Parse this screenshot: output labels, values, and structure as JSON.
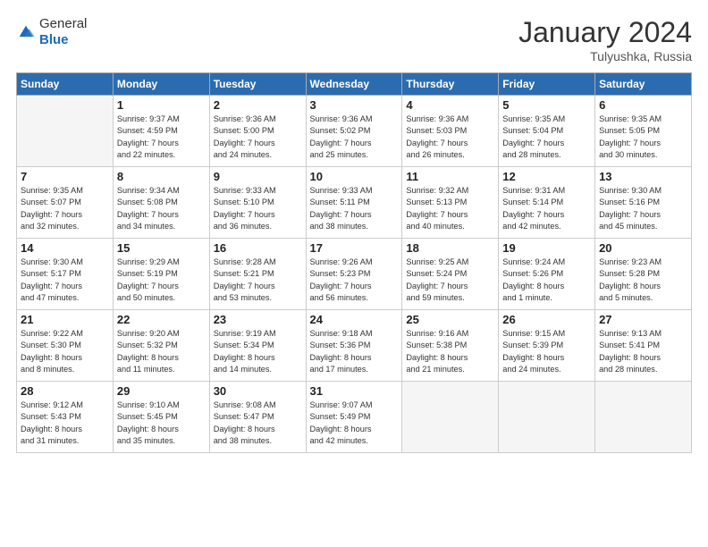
{
  "header": {
    "logo": {
      "general": "General",
      "blue": "Blue"
    },
    "title": "January 2024",
    "location": "Tulyushka, Russia"
  },
  "calendar": {
    "weekdays": [
      "Sunday",
      "Monday",
      "Tuesday",
      "Wednesday",
      "Thursday",
      "Friday",
      "Saturday"
    ],
    "weeks": [
      [
        {
          "day": "",
          "info": ""
        },
        {
          "day": "1",
          "info": "Sunrise: 9:37 AM\nSunset: 4:59 PM\nDaylight: 7 hours\nand 22 minutes."
        },
        {
          "day": "2",
          "info": "Sunrise: 9:36 AM\nSunset: 5:00 PM\nDaylight: 7 hours\nand 24 minutes."
        },
        {
          "day": "3",
          "info": "Sunrise: 9:36 AM\nSunset: 5:02 PM\nDaylight: 7 hours\nand 25 minutes."
        },
        {
          "day": "4",
          "info": "Sunrise: 9:36 AM\nSunset: 5:03 PM\nDaylight: 7 hours\nand 26 minutes."
        },
        {
          "day": "5",
          "info": "Sunrise: 9:35 AM\nSunset: 5:04 PM\nDaylight: 7 hours\nand 28 minutes."
        },
        {
          "day": "6",
          "info": "Sunrise: 9:35 AM\nSunset: 5:05 PM\nDaylight: 7 hours\nand 30 minutes."
        }
      ],
      [
        {
          "day": "7",
          "info": "Sunrise: 9:35 AM\nSunset: 5:07 PM\nDaylight: 7 hours\nand 32 minutes."
        },
        {
          "day": "8",
          "info": "Sunrise: 9:34 AM\nSunset: 5:08 PM\nDaylight: 7 hours\nand 34 minutes."
        },
        {
          "day": "9",
          "info": "Sunrise: 9:33 AM\nSunset: 5:10 PM\nDaylight: 7 hours\nand 36 minutes."
        },
        {
          "day": "10",
          "info": "Sunrise: 9:33 AM\nSunset: 5:11 PM\nDaylight: 7 hours\nand 38 minutes."
        },
        {
          "day": "11",
          "info": "Sunrise: 9:32 AM\nSunset: 5:13 PM\nDaylight: 7 hours\nand 40 minutes."
        },
        {
          "day": "12",
          "info": "Sunrise: 9:31 AM\nSunset: 5:14 PM\nDaylight: 7 hours\nand 42 minutes."
        },
        {
          "day": "13",
          "info": "Sunrise: 9:30 AM\nSunset: 5:16 PM\nDaylight: 7 hours\nand 45 minutes."
        }
      ],
      [
        {
          "day": "14",
          "info": "Sunrise: 9:30 AM\nSunset: 5:17 PM\nDaylight: 7 hours\nand 47 minutes."
        },
        {
          "day": "15",
          "info": "Sunrise: 9:29 AM\nSunset: 5:19 PM\nDaylight: 7 hours\nand 50 minutes."
        },
        {
          "day": "16",
          "info": "Sunrise: 9:28 AM\nSunset: 5:21 PM\nDaylight: 7 hours\nand 53 minutes."
        },
        {
          "day": "17",
          "info": "Sunrise: 9:26 AM\nSunset: 5:23 PM\nDaylight: 7 hours\nand 56 minutes."
        },
        {
          "day": "18",
          "info": "Sunrise: 9:25 AM\nSunset: 5:24 PM\nDaylight: 7 hours\nand 59 minutes."
        },
        {
          "day": "19",
          "info": "Sunrise: 9:24 AM\nSunset: 5:26 PM\nDaylight: 8 hours\nand 1 minute."
        },
        {
          "day": "20",
          "info": "Sunrise: 9:23 AM\nSunset: 5:28 PM\nDaylight: 8 hours\nand 5 minutes."
        }
      ],
      [
        {
          "day": "21",
          "info": "Sunrise: 9:22 AM\nSunset: 5:30 PM\nDaylight: 8 hours\nand 8 minutes."
        },
        {
          "day": "22",
          "info": "Sunrise: 9:20 AM\nSunset: 5:32 PM\nDaylight: 8 hours\nand 11 minutes."
        },
        {
          "day": "23",
          "info": "Sunrise: 9:19 AM\nSunset: 5:34 PM\nDaylight: 8 hours\nand 14 minutes."
        },
        {
          "day": "24",
          "info": "Sunrise: 9:18 AM\nSunset: 5:36 PM\nDaylight: 8 hours\nand 17 minutes."
        },
        {
          "day": "25",
          "info": "Sunrise: 9:16 AM\nSunset: 5:38 PM\nDaylight: 8 hours\nand 21 minutes."
        },
        {
          "day": "26",
          "info": "Sunrise: 9:15 AM\nSunset: 5:39 PM\nDaylight: 8 hours\nand 24 minutes."
        },
        {
          "day": "27",
          "info": "Sunrise: 9:13 AM\nSunset: 5:41 PM\nDaylight: 8 hours\nand 28 minutes."
        }
      ],
      [
        {
          "day": "28",
          "info": "Sunrise: 9:12 AM\nSunset: 5:43 PM\nDaylight: 8 hours\nand 31 minutes."
        },
        {
          "day": "29",
          "info": "Sunrise: 9:10 AM\nSunset: 5:45 PM\nDaylight: 8 hours\nand 35 minutes."
        },
        {
          "day": "30",
          "info": "Sunrise: 9:08 AM\nSunset: 5:47 PM\nDaylight: 8 hours\nand 38 minutes."
        },
        {
          "day": "31",
          "info": "Sunrise: 9:07 AM\nSunset: 5:49 PM\nDaylight: 8 hours\nand 42 minutes."
        },
        {
          "day": "",
          "info": ""
        },
        {
          "day": "",
          "info": ""
        },
        {
          "day": "",
          "info": ""
        }
      ]
    ]
  }
}
